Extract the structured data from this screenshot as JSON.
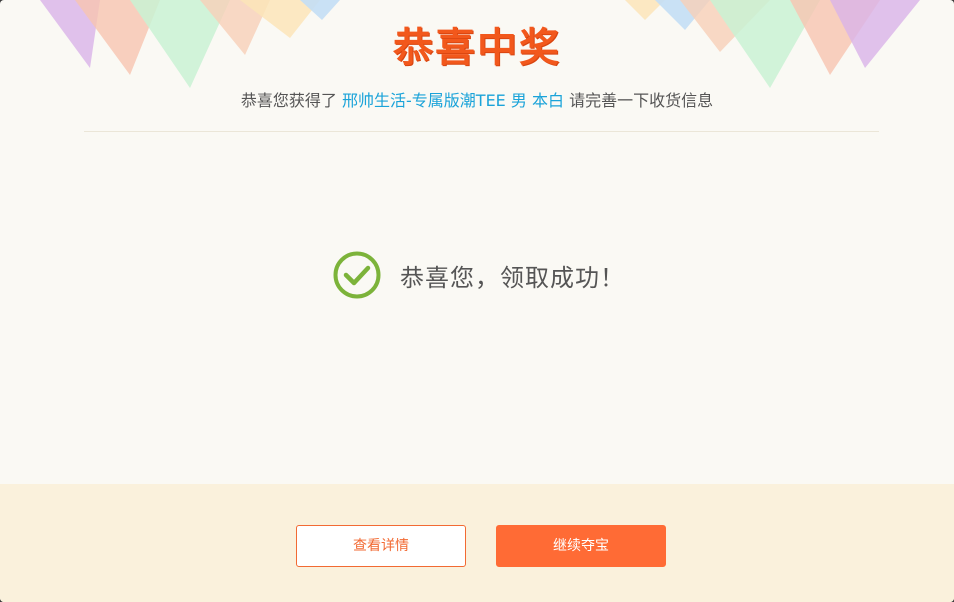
{
  "dialog": {
    "title": "恭喜中奖",
    "prize_prefix": "恭喜您获得了",
    "prize_name": "邢帅生活-专属版潮TEE 男 本白",
    "prize_suffix": "请完善一下收货信息",
    "success_message": "恭喜您，领取成功！",
    "icons": {
      "success": "check-circle-icon"
    }
  },
  "buttons": {
    "view_details": "查看详情",
    "continue": "继续夺宝"
  },
  "colors": {
    "title": "#f2581c",
    "prize_name": "#1aa3d9",
    "success_icon": "#7cb33a",
    "primary_button": "#ff6b35",
    "footer_bg": "#faf1dc"
  }
}
